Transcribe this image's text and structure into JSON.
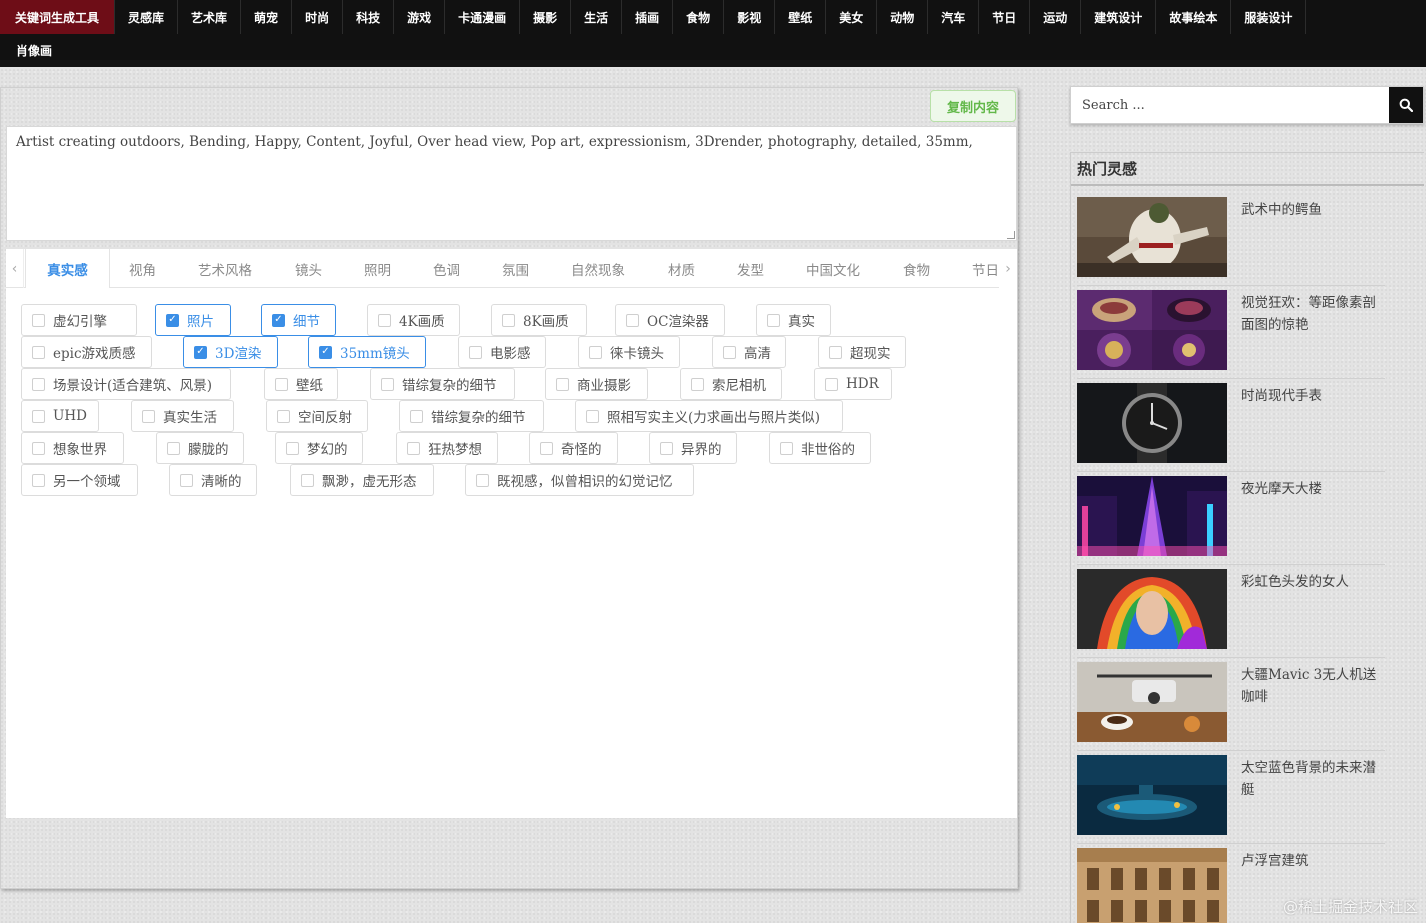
{
  "nav": {
    "row1": [
      "关键词生成工具",
      "灵感库",
      "艺术库",
      "萌宠",
      "时尚",
      "科技",
      "游戏",
      "卡通漫画",
      "摄影",
      "生活",
      "插画",
      "食物",
      "影视",
      "壁纸",
      "美女",
      "动物",
      "汽车",
      "节日",
      "运动",
      "建筑设计",
      "故事绘本",
      "服装设计"
    ],
    "row2": [
      "肖像画"
    ]
  },
  "editor": {
    "copy_label": "复制内容",
    "prompt_text": "Artist creating outdoors, Bending, Happy, Content, Joyful, Over head view, Pop art, expressionism, 3Drender, photography, detailed, 35mm,"
  },
  "tabs": [
    "真实感",
    "视角",
    "艺术风格",
    "镜头",
    "照明",
    "色调",
    "氛围",
    "自然现象",
    "材质",
    "发型",
    "中国文化",
    "食物",
    "节日"
  ],
  "tab_arrows": {
    "left": "‹",
    "right": "›"
  },
  "check_mark": "✓",
  "options": [
    {
      "label": "虚幻引擎",
      "checked": false
    },
    {
      "label": "照片",
      "checked": true
    },
    {
      "label": "细节",
      "checked": true
    },
    {
      "label": "4K画质",
      "checked": false
    },
    {
      "label": "8K画质",
      "checked": false
    },
    {
      "label": "OC渲染器",
      "checked": false
    },
    {
      "label": "真实",
      "checked": false
    },
    {
      "label": "epic游戏质感",
      "checked": false
    },
    {
      "label": "3D渲染",
      "checked": true
    },
    {
      "label": "35mm镜头",
      "checked": true
    },
    {
      "label": "电影感",
      "checked": false
    },
    {
      "label": "徕卡镜头",
      "checked": false
    },
    {
      "label": "高清",
      "checked": false
    },
    {
      "label": "超现实",
      "checked": false
    },
    {
      "label": "场景设计(适合建筑、风景)",
      "checked": false
    },
    {
      "label": "壁纸",
      "checked": false
    },
    {
      "label": "错综复杂的细节",
      "checked": false
    },
    {
      "label": "商业摄影",
      "checked": false
    },
    {
      "label": "索尼相机",
      "checked": false
    },
    {
      "label": "HDR",
      "checked": false
    },
    {
      "label": "UHD",
      "checked": false
    },
    {
      "label": "真实生活",
      "checked": false
    },
    {
      "label": "空间反射",
      "checked": false
    },
    {
      "label": "错综复杂的细节",
      "checked": false
    },
    {
      "label": "照相写实主义(力求画出与照片类似)",
      "checked": false
    },
    {
      "label": "想象世界",
      "checked": false
    },
    {
      "label": "朦胧的",
      "checked": false
    },
    {
      "label": "梦幻的",
      "checked": false
    },
    {
      "label": "狂热梦想",
      "checked": false
    },
    {
      "label": "奇怪的",
      "checked": false
    },
    {
      "label": "异界的",
      "checked": false
    },
    {
      "label": "非世俗的",
      "checked": false
    },
    {
      "label": "另一个领域",
      "checked": false
    },
    {
      "label": "清晰的",
      "checked": false
    },
    {
      "label": "飘渺，虚无形态",
      "checked": false
    },
    {
      "label": "既视感，似曾相识的幻觉记忆",
      "checked": false
    }
  ],
  "search": {
    "placeholder": "Search ..."
  },
  "sidebar": {
    "title": "热门灵感",
    "posts": [
      {
        "title": "武术中的鳄鱼",
        "icon": "martial-arts-crocodile-image"
      },
      {
        "title": "视觉狂欢：等距像素剖面图的惊艳",
        "icon": "isometric-pixel-cutaway-image"
      },
      {
        "title": "时尚现代手表",
        "icon": "modern-watch-image"
      },
      {
        "title": "夜光摩天大楼",
        "icon": "neon-skyscraper-image"
      },
      {
        "title": "彩虹色头发的女人",
        "icon": "rainbow-hair-woman-image"
      },
      {
        "title": "大疆Mavic 3无人机送咖啡",
        "icon": "drone-coffee-image"
      },
      {
        "title": "太空蓝色背景的未来潜艇",
        "icon": "future-submarine-image"
      },
      {
        "title": "卢浮宫建筑",
        "icon": "louvre-building-image"
      }
    ]
  },
  "watermark": "@稀土掘金技术社区",
  "colors": {
    "accent": "#3a8ee6",
    "nav_active": "#6e0d17",
    "nav_bg": "#111111",
    "copy_green": "#63b84a"
  }
}
